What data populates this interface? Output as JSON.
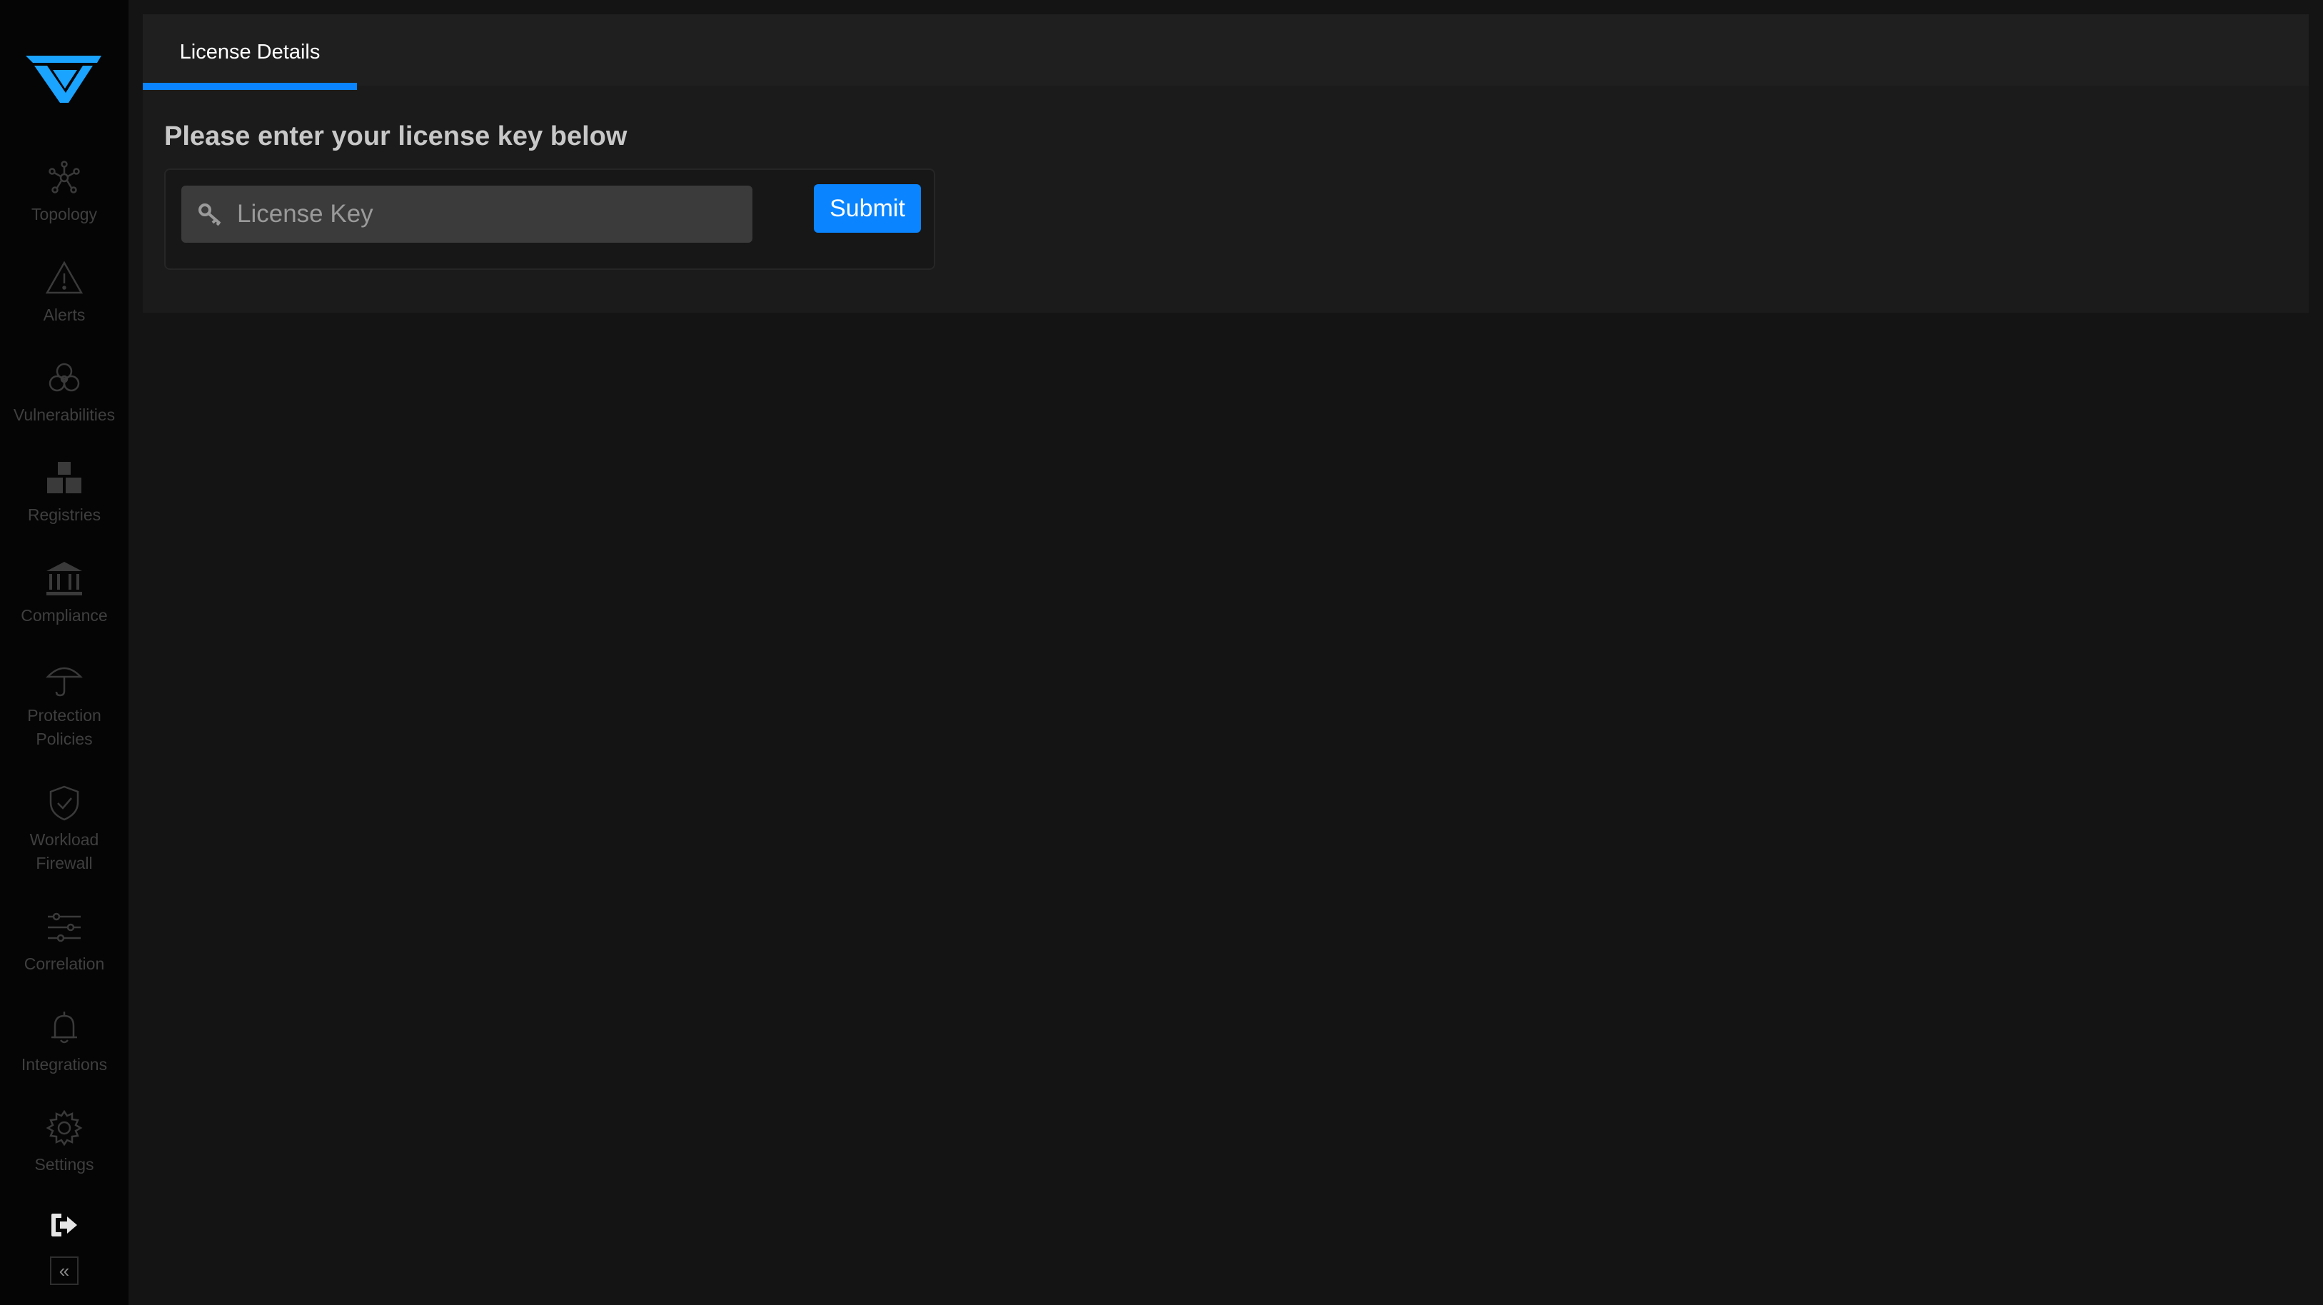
{
  "sidebar": {
    "logo": {
      "icon": "deepfence-logo-icon",
      "color": "#1aa3ff"
    },
    "items": [
      {
        "label": "Topology",
        "icon": "topology-icon"
      },
      {
        "label": "Alerts",
        "icon": "alert-triangle-icon"
      },
      {
        "label": "Vulnerabilities",
        "icon": "biohazard-icon"
      },
      {
        "label": "Registries",
        "icon": "registries-boxes-icon"
      },
      {
        "label": "Compliance",
        "icon": "institution-icon"
      },
      {
        "label": "Protection\nPolicies",
        "icon": "umbrella-icon"
      },
      {
        "label": "Workload\nFirewall",
        "icon": "shield-check-icon"
      },
      {
        "label": "Correlation",
        "icon": "sliders-icon"
      },
      {
        "label": "Integrations",
        "icon": "bell-icon"
      },
      {
        "label": "Settings",
        "icon": "gear-icon"
      }
    ],
    "logout_icon": "logout-icon",
    "collapse_glyph": "«"
  },
  "main": {
    "tabs": [
      {
        "label": "License Details",
        "active": true
      }
    ],
    "heading": "Please enter your license key below",
    "form": {
      "input_placeholder": "License Key",
      "input_value": "",
      "input_icon": "key-icon",
      "submit_label": "Submit"
    }
  },
  "colors": {
    "accent": "#0a84ff",
    "sidebar_bg": "#050505",
    "page_bg": "#141414",
    "panel_bg": "#1b1b1b",
    "muted_text": "#3f3f3f"
  }
}
